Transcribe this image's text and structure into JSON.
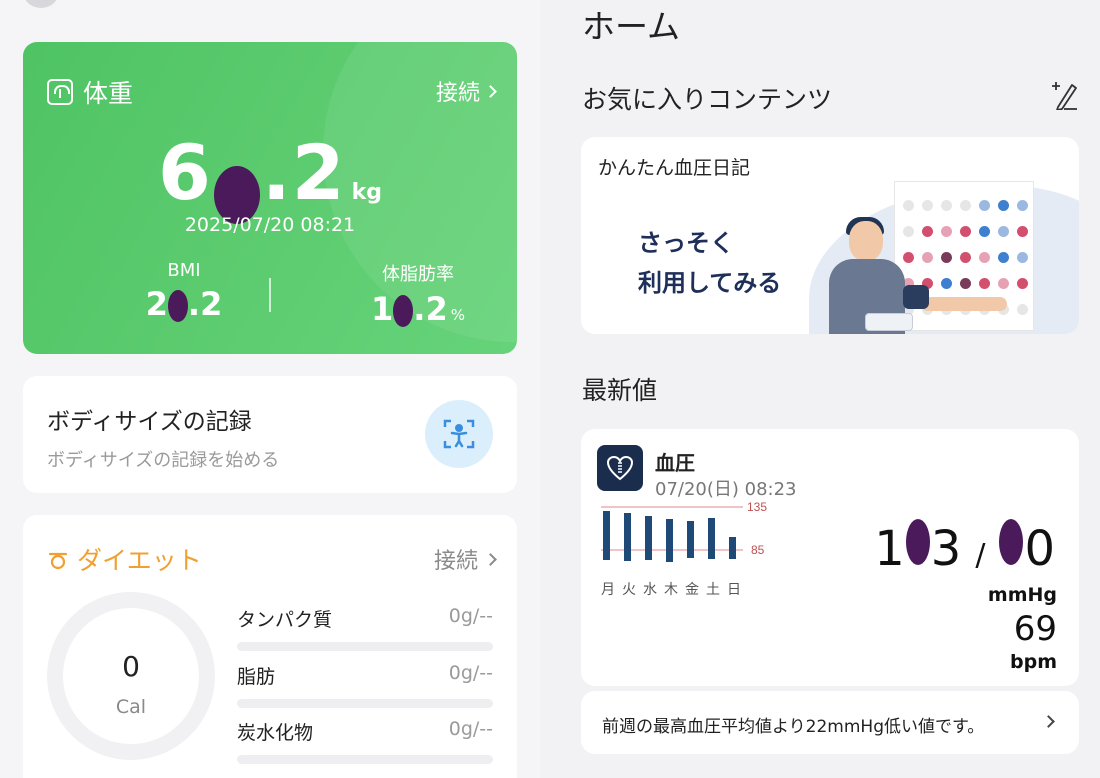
{
  "left": {
    "weight": {
      "title": "体重",
      "connect_label": "接続",
      "value_prefix": "6",
      "value_suffix": ".2",
      "unit": "kg",
      "datetime": "2025/07/20 08:21",
      "bmi_label": "BMI",
      "bmi_prefix": "2",
      "bmi_suffix": ".2",
      "fat_label": "体脂肪率",
      "fat_prefix": "1",
      "fat_suffix": ".2",
      "fat_unit": "%"
    },
    "body_size": {
      "title": "ボディサイズの記録",
      "subtitle": "ボディサイズの記録を始める"
    },
    "diet": {
      "title": "ダイエット",
      "connect_label": "接続",
      "calories": "0",
      "calories_unit": "Cal",
      "nutrients": [
        {
          "name": "タンパク質",
          "value": "0g/--"
        },
        {
          "name": "脂肪",
          "value": "0g/--"
        },
        {
          "name": "炭水化物",
          "value": "0g/--"
        }
      ]
    }
  },
  "right": {
    "home_title": "ホーム",
    "favorites_title": "お気に入りコンテンツ",
    "banner": {
      "title": "かんたん血圧日記",
      "cta_line1": "さっそく",
      "cta_line2": "利用してみる"
    },
    "latest_title": "最新値",
    "blood_pressure": {
      "name": "血圧",
      "datetime": "07/20(日) 08:23",
      "ref_high": "135",
      "ref_low": "85",
      "weekdays": [
        "月",
        "火",
        "水",
        "木",
        "金",
        "土",
        "日"
      ],
      "systolic_prefix": "1",
      "systolic_suffix": "3",
      "diastolic_suffix": "0",
      "pressure_unit": "mmHg",
      "pulse": "69",
      "pulse_unit": "bpm"
    },
    "info_message": "前週の最高血圧平均値より22mmHg低い値です。"
  },
  "colors": {
    "weight_card": "#5dcc70",
    "diet_accent": "#f0a030",
    "bp_bar": "#1f4a78",
    "reference_line": "#e08a8a",
    "navy_text": "#1e2f5a"
  }
}
